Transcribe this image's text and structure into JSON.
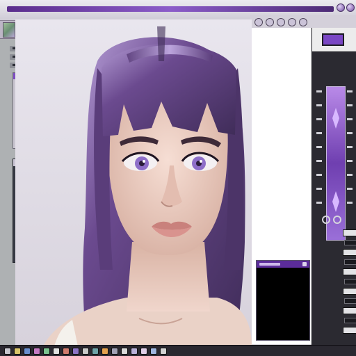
{
  "app": {
    "name": "image editor"
  },
  "colors": {
    "accent": "#7a47c4",
    "hair": "#6b4a8f",
    "iris": "#8e6ec8",
    "skin": "#efd2c6",
    "dark_panel": "#2b2a31"
  },
  "icons": {
    "window_buttons": [
      "minimize-icon",
      "maximize-icon",
      "close-icon"
    ],
    "toolbar": [
      "layer-thumb-icon",
      "brush-icon",
      "eraser-icon",
      "zoom-icon"
    ],
    "right_strip": [
      "settings-icon",
      "history-icon",
      "info-icon"
    ]
  },
  "canvas": {
    "subject": "portrait"
  }
}
